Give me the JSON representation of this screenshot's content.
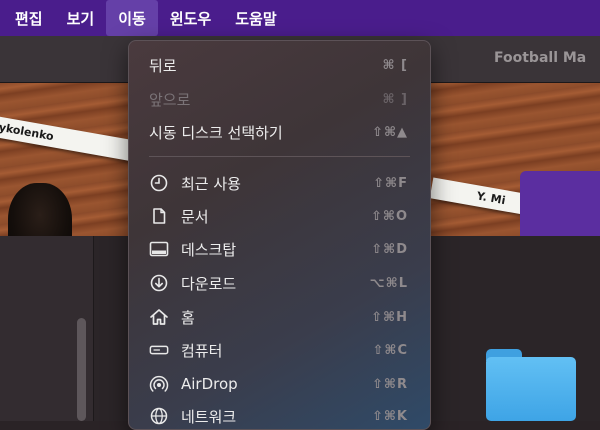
{
  "menubar": {
    "items": [
      {
        "label": "편집"
      },
      {
        "label": "보기"
      },
      {
        "label": "이동"
      },
      {
        "label": "윈도우"
      },
      {
        "label": "도움말"
      }
    ],
    "active_index": 2
  },
  "window": {
    "title": "Football Ma"
  },
  "photo": {
    "nameplate_left": "ykolenko",
    "nameplate_right": "Y. Mi"
  },
  "go_menu": {
    "items": [
      {
        "label": "뒤로",
        "shortcut": "⌘ [",
        "enabled": true
      },
      {
        "label": "앞으로",
        "shortcut": "⌘ ]",
        "enabled": false
      },
      {
        "label": "시동 디스크 선택하기",
        "shortcut": "⇧⌘▲",
        "enabled": true
      },
      {
        "label": "최근 사용",
        "shortcut": "⇧⌘F",
        "icon": "clock-icon"
      },
      {
        "label": "문서",
        "shortcut": "⇧⌘O",
        "icon": "document-icon"
      },
      {
        "label": "데스크탑",
        "shortcut": "⇧⌘D",
        "icon": "desktop-icon"
      },
      {
        "label": "다운로드",
        "shortcut": "⌥⌘L",
        "icon": "download-icon"
      },
      {
        "label": "홈",
        "shortcut": "⇧⌘H",
        "icon": "home-icon"
      },
      {
        "label": "컴퓨터",
        "shortcut": "⇧⌘C",
        "icon": "computer-icon"
      },
      {
        "label": "AirDrop",
        "shortcut": "⇧⌘R",
        "icon": "airdrop-icon"
      },
      {
        "label": "네트워크",
        "shortcut": "⇧⌘K",
        "icon": "network-icon"
      }
    ]
  },
  "colors": {
    "menubar_bg": "#4a1d8c",
    "menubar_active": "#6540a8",
    "folder_blue": "#3ea4e6"
  }
}
